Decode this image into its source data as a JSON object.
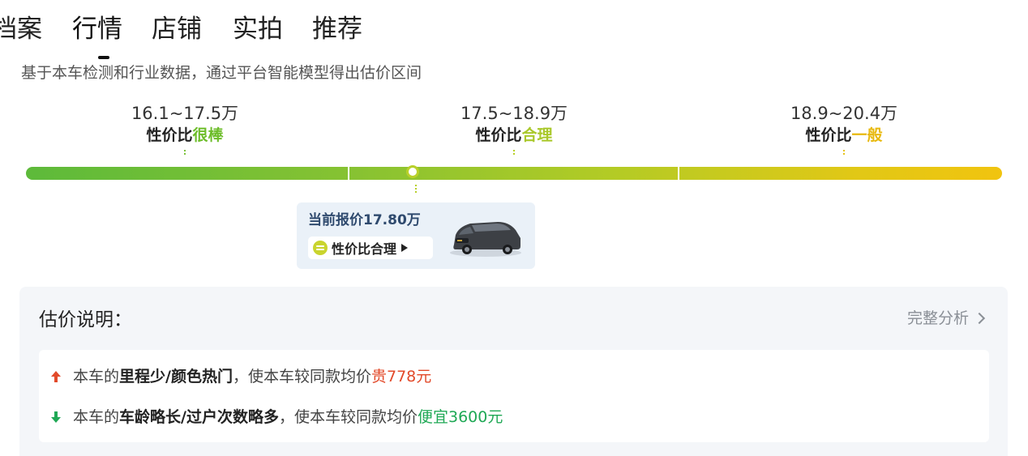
{
  "tabs": [
    {
      "label": "档案"
    },
    {
      "label": "行情"
    },
    {
      "label": "店铺"
    },
    {
      "label": "实拍"
    },
    {
      "label": "推荐"
    }
  ],
  "active_tab": "行情",
  "subtitle": "基于本车检测和行业数据，通过平台智能模型得出估价区间",
  "ranges": [
    {
      "price": "16.1~17.5万",
      "verdict_prefix": "性价比",
      "verdict_word": "很棒",
      "color": "#6dbd2a"
    },
    {
      "price": "17.5~18.9万",
      "verdict_prefix": "性价比",
      "verdict_word": "合理",
      "color": "#a9c82a"
    },
    {
      "price": "18.9~20.4万",
      "verdict_prefix": "性价比",
      "verdict_word": "一般",
      "color": "#e8b90e"
    }
  ],
  "current": {
    "label": "当前报价17.80万",
    "value_button": "性价比合理"
  },
  "explain": {
    "title": "估价说明：",
    "full_analysis": "完整分析",
    "reasons": [
      {
        "direction": "up",
        "prefix": "本车的",
        "highlight": "里程少/颜色热门",
        "middle": "，使本车较同款均价",
        "delta": "贵778元"
      },
      {
        "direction": "down",
        "prefix": "本车的",
        "highlight": "车龄略长/过户次数略多",
        "middle": "，使本车较同款均价",
        "delta": "便宜3600元"
      }
    ]
  },
  "colors": {
    "up": "#e24a2a",
    "down": "#1fa855",
    "bar_start": "#5dba3a",
    "bar_end": "#f1c40f"
  }
}
